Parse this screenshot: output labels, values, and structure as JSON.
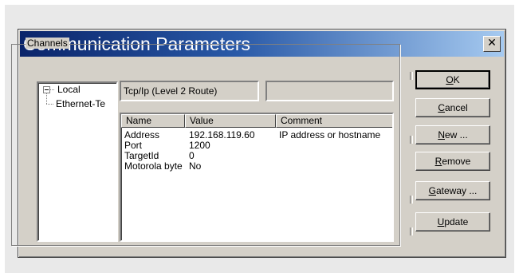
{
  "dialog": {
    "title": "Communication Parameters",
    "close_glyph": "✕"
  },
  "channels": {
    "group_label": "Channels",
    "tree": [
      {
        "label": "Local",
        "expanded": true
      },
      {
        "label": "Ethernet-Te"
      }
    ],
    "driver_label": "Tcp/Ip (Level 2 Route)",
    "extra_field_value": ""
  },
  "params": {
    "columns": [
      "Name",
      "Value",
      "Comment"
    ],
    "rows": [
      {
        "name": "Address",
        "value": "192.168.119.60",
        "comment": "IP address or hostname"
      },
      {
        "name": "Port",
        "value": "1200",
        "comment": ""
      },
      {
        "name": "TargetId",
        "value": "0",
        "comment": ""
      },
      {
        "name": "Motorola byte",
        "value": "No",
        "comment": ""
      }
    ]
  },
  "buttons": [
    {
      "first": "O",
      "rest": "K"
    },
    {
      "first": "C",
      "rest": "ancel"
    },
    {
      "first": "N",
      "rest": "ew ..."
    },
    {
      "first": "R",
      "rest": "emove"
    },
    {
      "first": "G",
      "rest": "ateway ..."
    },
    {
      "first": "U",
      "rest": "pdate"
    }
  ]
}
